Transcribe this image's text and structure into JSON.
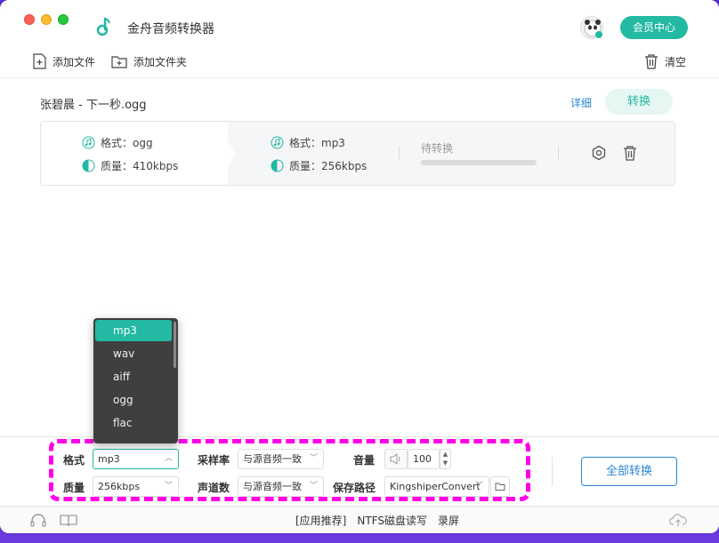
{
  "window": {
    "title": "金舟音频转换器"
  },
  "header": {
    "vip_label": "会员中心"
  },
  "toolbar": {
    "add_file": "添加文件",
    "add_folder": "添加文件夹",
    "clear": "清空"
  },
  "file": {
    "name": "张碧晨 - 下一秒.ogg",
    "detail_label": "详细",
    "convert_label": "转换",
    "source": {
      "format": "格式：ogg",
      "quality": "质量：410kbps"
    },
    "target": {
      "format": "格式：mp3",
      "quality": "质量：256kbps"
    },
    "status": "待转换",
    "progress": 0
  },
  "settings": {
    "format_label": "格式",
    "format_value": "mp3",
    "quality_label": "质量",
    "quality_value": "256kbps",
    "samplerate_label": "采样率",
    "samplerate_value": "与源音频一致",
    "channels_label": "声道数",
    "channels_value": "与源音频一致",
    "volume_label": "音量",
    "volume_value": "100",
    "savepath_label": "保存路径",
    "savepath_value": "KingshiperConvert"
  },
  "convert_all_label": "全部转换",
  "format_dropdown": {
    "options": [
      "mp3",
      "wav",
      "aiff",
      "ogg",
      "flac"
    ],
    "selected": "mp3"
  },
  "footer": {
    "links": [
      "[应用推荐]",
      "NTFS磁盘读写",
      "录屏"
    ]
  },
  "colors": {
    "accent": "#23b9a3",
    "link": "#2a86d4",
    "highlight": "#ff00e6"
  }
}
